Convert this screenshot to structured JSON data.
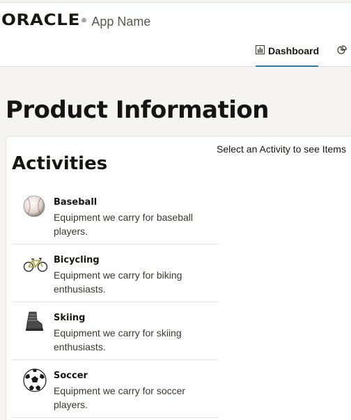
{
  "header": {
    "logo_text": "ORACLE",
    "app_name": "App Name"
  },
  "nav": {
    "tabs": [
      {
        "label": "Dashboard",
        "icon": "bar-chart-icon",
        "active": true
      },
      {
        "label": "",
        "icon": "pie-chart-icon",
        "active": false
      }
    ]
  },
  "page": {
    "title": "Product Information"
  },
  "activities": {
    "title": "Activities",
    "hint": "Select an Activity to see Items",
    "items": [
      {
        "name": "Baseball",
        "description": "Equipment we carry for baseball players.",
        "icon": "baseball-icon"
      },
      {
        "name": "Bicycling",
        "description": "Equipment we carry for biking enthusiasts.",
        "icon": "bicycle-icon"
      },
      {
        "name": "Skiing",
        "description": "Equipment we carry for skiing enthusiasts.",
        "icon": "ski-boot-icon"
      },
      {
        "name": "Soccer",
        "description": "Equipment we carry for soccer players.",
        "icon": "soccer-ball-icon"
      }
    ]
  },
  "colors": {
    "accent": "#227e9e",
    "background": "#f6f4f2",
    "text": "#161513"
  }
}
